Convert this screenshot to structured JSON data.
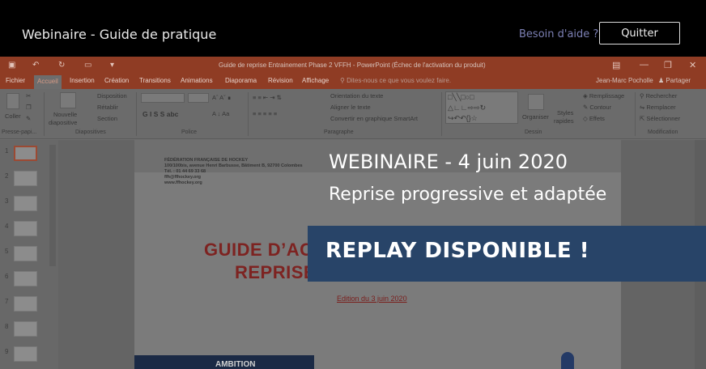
{
  "webinar": {
    "title": "Webinaire - Guide de pratique",
    "help_link": "Besoin d'aide ?",
    "quit_button": "Quitter"
  },
  "powerpoint": {
    "window_title": "Guide de reprise Entrainement Phase 2 VFFH - PowerPoint (Échec de l'activation du produit)",
    "tabs": [
      "Fichier",
      "Accueil",
      "Insertion",
      "Création",
      "Transitions",
      "Animations",
      "Diaporama",
      "Révision",
      "Affichage"
    ],
    "search_placeholder": "Dites-nous ce que vous voulez faire.",
    "user": "Jean-Marc Pocholle",
    "share": "Partager",
    "ribbon": {
      "coller": "Coller",
      "nouvelle": "Nouvelle",
      "diapositive": "diapositive",
      "disposition": "Disposition",
      "retablir": "Rétablir",
      "section": "Section",
      "font_buttons": "G I S S abc",
      "orientation": "Orientation du texte",
      "aligner": "Aligner le texte",
      "smartart": "Convertir en graphique SmartArt",
      "organiser": "Organiser",
      "styles": "Styles",
      "rapides": "rapides",
      "remplissage": "Remplissage",
      "contour": "Contour",
      "effets": "Effets",
      "rechercher": "Rechercher",
      "remplacer": "Remplacer",
      "selectionner": "Sélectionner",
      "groups": {
        "presse": "Presse-papi...",
        "diapositives": "Diapositives",
        "police": "Police",
        "paragraphe": "Paragraphe",
        "dessin": "Dessin",
        "modification": "Modification"
      }
    },
    "thumbnails": [
      "1",
      "2",
      "3",
      "4",
      "5",
      "6",
      "7",
      "8",
      "9"
    ],
    "slide": {
      "federation": "FÉDÉRATION FRANÇAISE DE HOCKEY",
      "address": "100/100bis, avenue Henri Barbusse, Bâtiment B, 92700 Colombes",
      "tel": "Tél. : 01 44 69 33 68",
      "email": "ffh@ffhockey.org",
      "web": "www.ffhockey.org",
      "title_line1": "GUIDE D’AC",
      "title_line2": "REPRISE",
      "edition": "Edition du 3 juin 2020",
      "ambition": "AMBITION"
    }
  },
  "overlay": {
    "line1": "WEBINAIRE - 4 juin 2020",
    "line2": "Reprise progressive et adaptée",
    "replay": "REPLAY DISPONIBLE !"
  }
}
